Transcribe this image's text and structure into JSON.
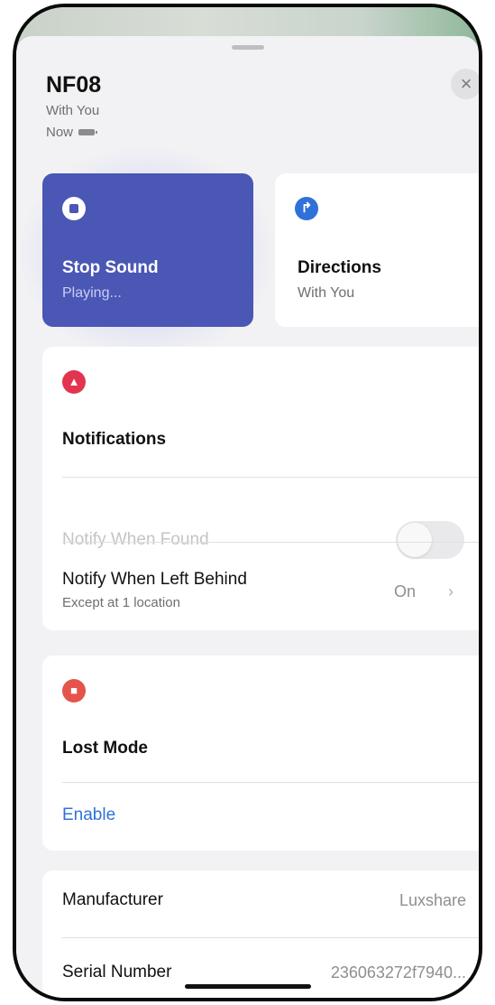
{
  "header": {
    "title": "NF08",
    "subtitle": "With You",
    "status": "Now"
  },
  "actions": {
    "stop_sound": {
      "title": "Stop Sound",
      "subtitle": "Playing..."
    },
    "directions": {
      "title": "Directions",
      "subtitle": "With You"
    }
  },
  "notifications": {
    "heading": "Notifications",
    "notify_found_label": "Notify When Found",
    "notify_found_enabled": false,
    "left_behind_label": "Notify When Left Behind",
    "left_behind_sub": "Except at 1 location",
    "left_behind_value": "On"
  },
  "lost_mode": {
    "heading": "Lost Mode",
    "enable_label": "Enable"
  },
  "info": {
    "manufacturer_label": "Manufacturer",
    "manufacturer_value": "Luxshare",
    "serial_label": "Serial Number",
    "serial_value": "236063272f7940..."
  },
  "icons": {
    "close": "close-icon",
    "stop": "stop-icon",
    "directions": "directions-icon",
    "bell": "bell-icon",
    "lock": "lock-icon",
    "battery": "battery-icon"
  },
  "colors": {
    "stop_tile": "#4a57b5",
    "directions_icon": "#2f71d8",
    "bell_icon": "#e2344f",
    "lock_icon": "#e4544b",
    "link": "#2f71d8"
  }
}
